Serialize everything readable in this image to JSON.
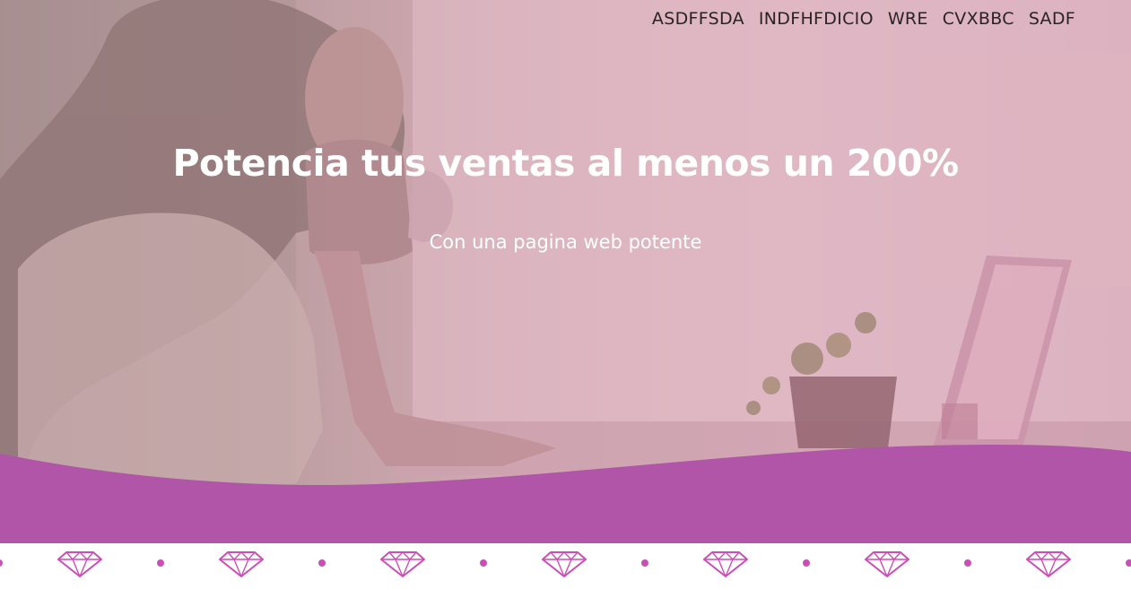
{
  "nav": {
    "items": [
      {
        "label": "ASDFFSDA"
      },
      {
        "label": "INDFHFDICIO"
      },
      {
        "label": "WRE"
      },
      {
        "label": "CVXBBC"
      },
      {
        "label": "SADF"
      }
    ]
  },
  "hero": {
    "headline": "Potencia tus ventas al menos un 200%",
    "subheadline": "Con una pagina web potente"
  },
  "colors": {
    "accent": "#b055a7",
    "diamond": "#c94fb6",
    "overlay": "#d7a8b9",
    "text_light": "#ffffff",
    "text_dark": "#2b2326"
  },
  "decor": {
    "background_image": "woman-drinking-coffee-at-laptop-photo",
    "divider_pattern": "diamond-icon"
  }
}
